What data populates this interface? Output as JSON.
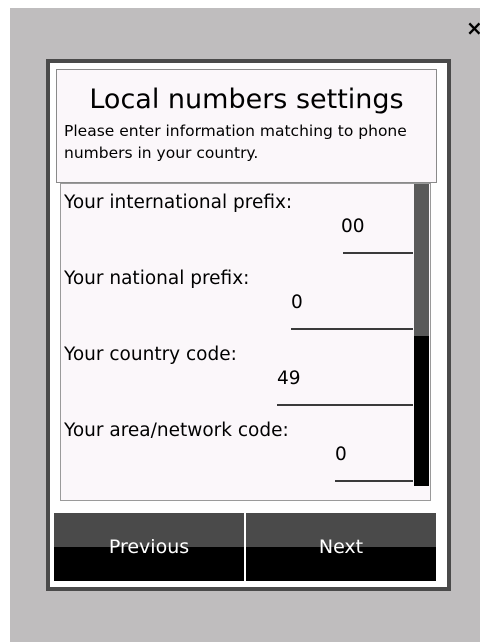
{
  "window": {
    "close_glyph": "×"
  },
  "dialog": {
    "title": "Local numbers settings",
    "subtitle": "Please enter information matching to phone numbers in your country."
  },
  "fields": [
    {
      "label": "Your international prefix:",
      "value": "00"
    },
    {
      "label": "Your national prefix:",
      "value": "0"
    },
    {
      "label": "Your country code:",
      "value": "49"
    },
    {
      "label": "Your area/network code:",
      "value": "0"
    }
  ],
  "buttons": {
    "previous": "Previous",
    "next": "Next"
  },
  "colors": {
    "backdrop": "#bfbdbe",
    "frame": "#4a4a4a",
    "panel": "#fbf7fa",
    "button_top": "#4a4a4a",
    "button_bottom": "#000000"
  },
  "icons": {
    "close": "close-icon"
  }
}
